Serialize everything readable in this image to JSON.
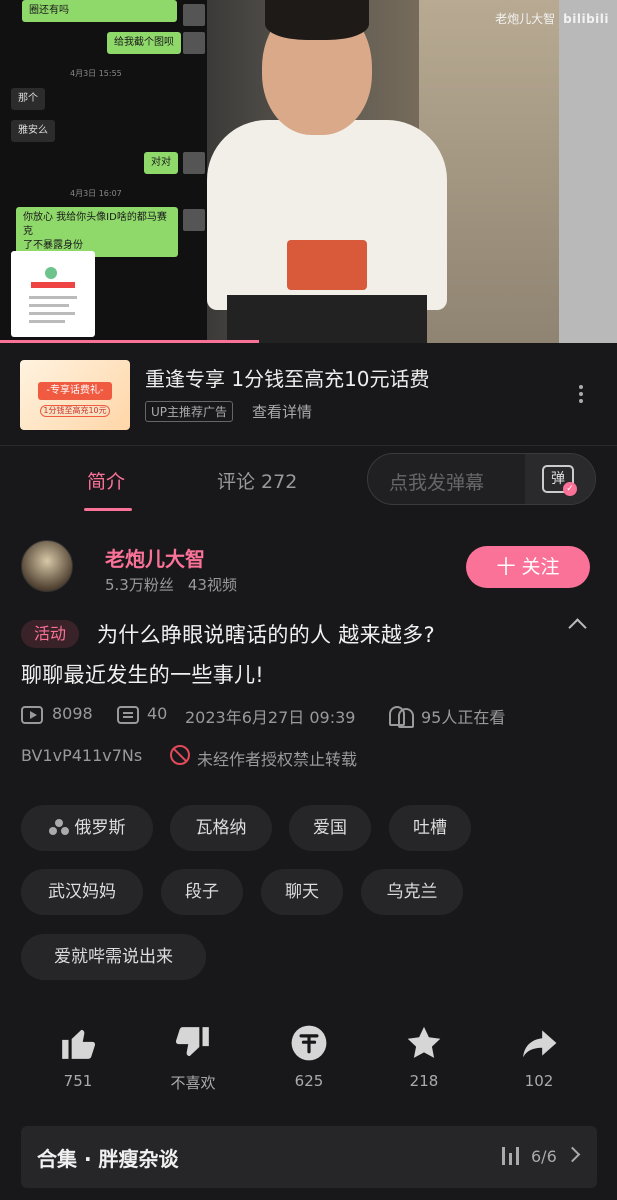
{
  "video": {
    "watermark_channel": "老炮儿大智",
    "watermark_logo": "bilibili",
    "progress_fraction": 0.42,
    "chat": {
      "msg_top": "圈还有吗",
      "msg_send1": "给我截个图呗",
      "time1": "4月3日 15:55",
      "msg_recv1": "那个",
      "msg_recv2": "雅安么",
      "msg_send2": "对对",
      "time2": "4月3日 16:07",
      "msg_send3_line1": "你放心 我给你头像ID啥的都马赛克",
      "msg_send3_line2": "了不暴露身份"
    }
  },
  "ad": {
    "image_tag": "-专享话费礼-",
    "image_sub": "1分钱至高充10元",
    "title": "重逢专享 1分钱至高充10元话费",
    "badge": "UP主推荐广告",
    "details": "查看详情"
  },
  "tabs": {
    "intro": "简介",
    "comments": "评论 272"
  },
  "danmaku": {
    "placeholder": "点我发弹幕",
    "icon_glyph": "弹"
  },
  "author": {
    "name": "老炮儿大智",
    "fans": "5.3万粉丝",
    "videos": "43视频",
    "follow_label": "十 关注"
  },
  "video_info": {
    "activity_tag": "活动",
    "title_line1": "为什么睁眼说瞎话的的人 越来越多?",
    "title_line2": "聊聊最近发生的一些事儿!",
    "plays": "8098",
    "danmaku_count": "40",
    "date": "2023年6月27日 09:39",
    "watching": "95人正在看",
    "bvid": "BV1vP411v7Ns",
    "no_repost": "未经作者授权禁止转载"
  },
  "tags": [
    "俄罗斯",
    "瓦格纳",
    "爱国",
    "吐槽",
    "武汉妈妈",
    "段子",
    "聊天",
    "乌克兰",
    "爱就哔需说出来"
  ],
  "actions": {
    "like": "751",
    "dislike": "不喜欢",
    "coin": "625",
    "favorite": "218",
    "share": "102"
  },
  "collection": {
    "name": "合集 · 胖瘦杂谈",
    "count": "6/6"
  },
  "colors": {
    "accent": "#fb7299",
    "background": "#18181a",
    "chip": "#262628"
  }
}
